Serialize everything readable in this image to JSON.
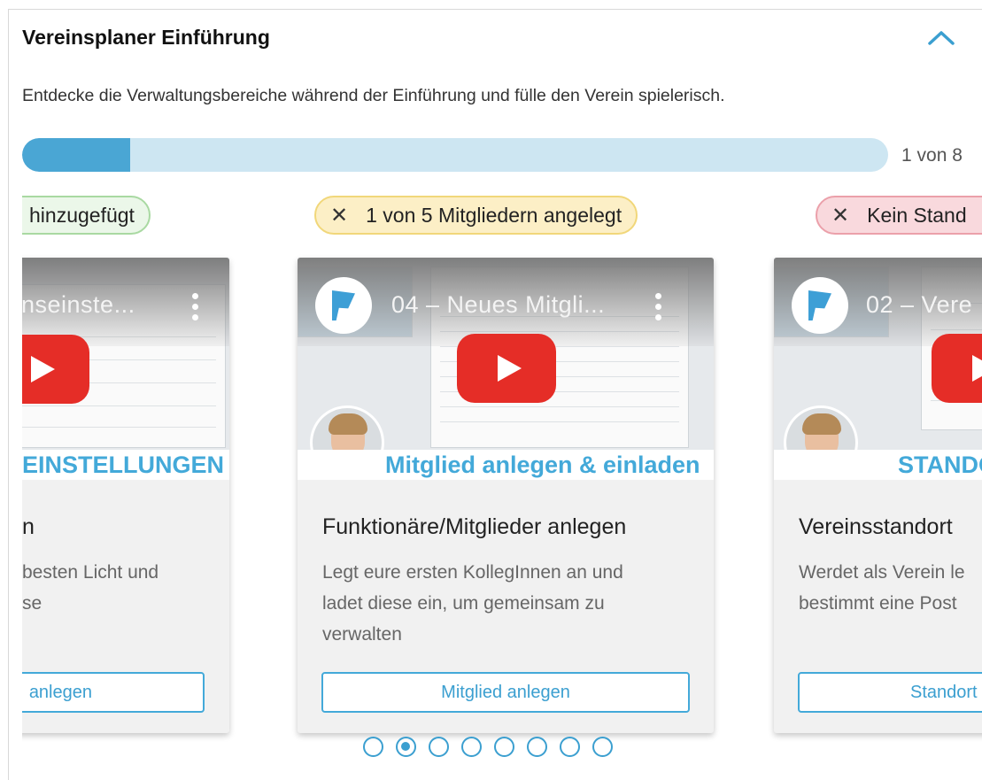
{
  "header": {
    "title": "Vereinsplaner Einführung",
    "collapse_icon": "chevron-up-icon"
  },
  "description": "Entdecke die Verwaltungsbereiche während der Einführung und fülle den Verein spielerisch.",
  "progress": {
    "fraction": 0.125,
    "label": "1 von 8"
  },
  "colors": {
    "accent": "#43a9d9",
    "progress_fill": "#4aa6d4",
    "progress_track": "#cde6f2",
    "youtube_red": "#e52d27"
  },
  "cards": [
    {
      "status": "hinzugefügt",
      "status_color": "green",
      "video_title": "nseinste...",
      "banner": "EINSTELLUNGEN",
      "title": "n",
      "description_lines": [
        "besten Licht und",
        "se"
      ],
      "button": "anlegen"
    },
    {
      "status": "1 von 5 Mitgliedern angelegt",
      "status_color": "yellow",
      "video_title": "04 – Neues Mitgli...",
      "banner": "Mitglied anlegen & einladen",
      "title": "Funktionäre/Mitglieder anlegen",
      "description_lines": [
        "Legt eure ersten KollegInnen an und",
        "ladet diese ein, um gemeinsam zu",
        "verwalten"
      ],
      "button": "Mitglied anlegen"
    },
    {
      "status": "Kein Stand",
      "status_color": "red",
      "video_title": "02 – Vere",
      "banner": "STANDO",
      "title": "Vereinsstandort",
      "description_lines": [
        "Werdet als Verein le",
        "bestimmt eine Post"
      ],
      "button": "Standort"
    }
  ],
  "pagination": {
    "count": 8,
    "active_index": 1
  }
}
